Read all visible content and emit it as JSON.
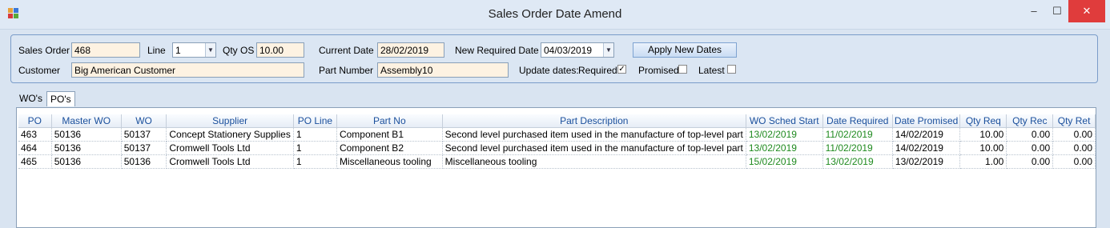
{
  "window": {
    "title": "Sales Order Date Amend",
    "minimize": "–",
    "maximize": "☐",
    "close": "✕"
  },
  "form": {
    "sales_order_label": "Sales Order",
    "sales_order_value": "468",
    "line_label": "Line",
    "line_value": "1",
    "qty_os_label": "Qty OS",
    "qty_os_value": "10.00",
    "current_date_label": "Current Date",
    "current_date_value": "28/02/2019",
    "new_required_date_label": "New Required Date",
    "new_required_date_value": "04/03/2019",
    "apply_button": "Apply New Dates",
    "customer_label": "Customer",
    "customer_value": "Big American Customer",
    "part_number_label": "Part Number",
    "part_number_value": "Assembly10",
    "update_dates_label": "Update dates:",
    "required_label": "Required",
    "required_checked": true,
    "promised_label": "Promised",
    "promised_checked": false,
    "latest_label": "Latest",
    "latest_checked": false
  },
  "tabs": [
    {
      "label": "WO's",
      "active": false
    },
    {
      "label": "PO's",
      "active": true
    }
  ],
  "grid": {
    "columns": [
      "PO",
      "Master WO",
      "WO",
      "Supplier",
      "PO Line",
      "Part No",
      "Part Description",
      "WO Sched Start",
      "Date Required",
      "Date Promised",
      "Qty Req",
      "Qty Rec",
      "Qty Ret"
    ],
    "rows": [
      [
        "463",
        "50136",
        "50137",
        "Concept Stationery Supplies",
        "1",
        "Component B1",
        "Second level purchased item used in the manufacture of top-level part",
        "13/02/2019",
        "11/02/2019",
        "14/02/2019",
        "10.00",
        "0.00",
        "0.00"
      ],
      [
        "464",
        "50136",
        "50137",
        "Cromwell Tools Ltd",
        "1",
        "Component B2",
        "Second level purchased item used in the manufacture of top-level part",
        "13/02/2019",
        "11/02/2019",
        "14/02/2019",
        "10.00",
        "0.00",
        "0.00"
      ],
      [
        "465",
        "50136",
        "50136",
        "Cromwell Tools Ltd",
        "1",
        "Miscellaneous tooling",
        "Miscellaneous tooling",
        "15/02/2019",
        "13/02/2019",
        "13/02/2019",
        "1.00",
        "0.00",
        "0.00"
      ]
    ]
  },
  "colors": {
    "date_green": "#1f8a1f",
    "header_blue": "#1a4f9c",
    "field_bg": "#fdf2e2"
  }
}
